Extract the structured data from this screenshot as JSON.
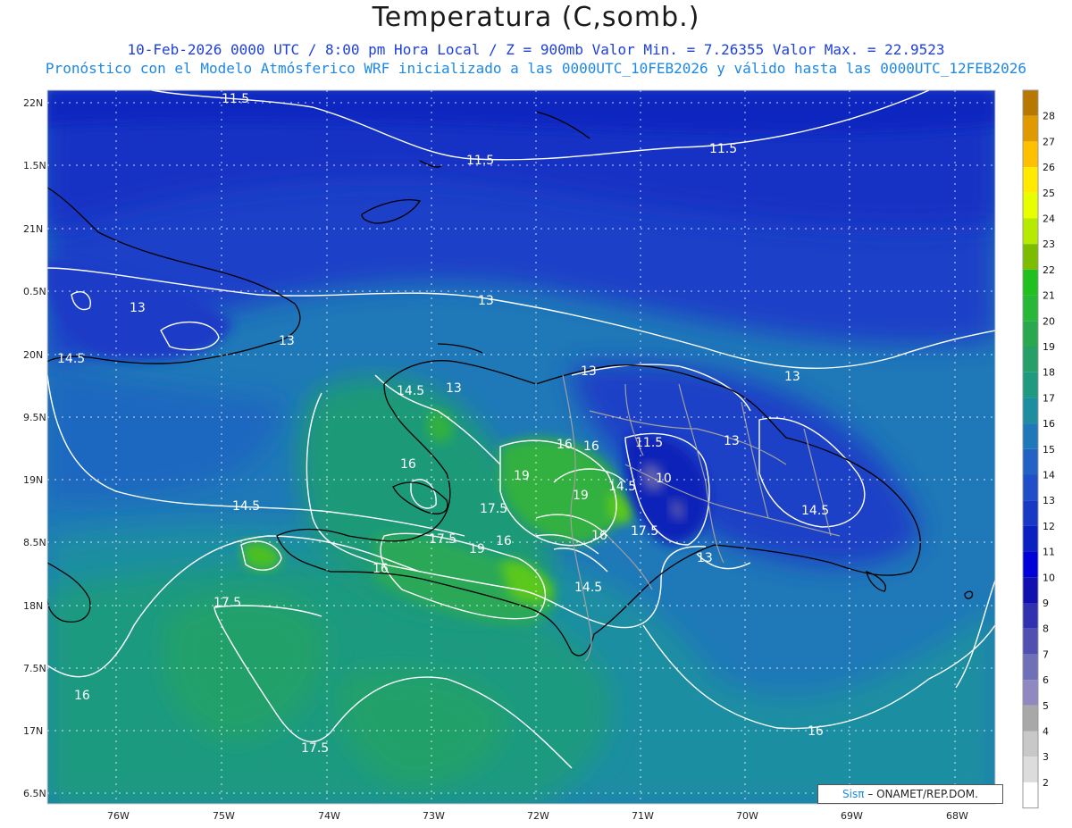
{
  "header": {
    "title": "Temperatura (C,somb.)",
    "subtitle_line1": "10-Feb-2026  0000 UTC / 8:00 pm Hora Local / Z = 900mb    Valor Min. = 7.26355  Valor Max. = 22.9523",
    "subtitle_line2": "Pronóstico con el Modelo Atmósferico WRF inicializado a las 0000UTC_10FEB2026 y válido hasta las  0000UTC_12FEB2026"
  },
  "map": {
    "lat_labels": [
      "22N",
      "1.5N",
      "21N",
      "0.5N",
      "20N",
      "9.5N",
      "19N",
      "8.5N",
      "18N",
      "7.5N",
      "17N",
      "6.5N"
    ],
    "lon_labels": [
      "76W",
      "75W",
      "74W",
      "73W",
      "72W",
      "71W",
      "70W",
      "69W",
      "68W"
    ],
    "contour_labels": [
      "11.5",
      "11.5",
      "11.5",
      "13",
      "13",
      "13",
      "14.5",
      "14.5",
      "13",
      "13",
      "11.5",
      "13",
      "16",
      "16",
      "16",
      "19",
      "19",
      "14.5",
      "10",
      "17.5",
      "17.5",
      "16",
      "17.5",
      "14.5",
      "16",
      "19",
      "16",
      "14.5",
      "13",
      "14.5",
      "17.5",
      "16",
      "17.5",
      "16"
    ],
    "colors": {
      "cold_10": "#0a1fbf",
      "c11": "#1432c8",
      "c12": "#1e48cc",
      "c13": "#1f64c4",
      "c14": "#2080b8",
      "c15": "#2398a8",
      "c16": "#1a9a7c",
      "c17": "#27a06a",
      "c18": "#2aa85a",
      "c19": "#22b33a",
      "c20": "#3cc42a",
      "c21": "#5ad21c"
    }
  },
  "colorbar": {
    "labels": [
      "28",
      "27",
      "26",
      "25",
      "24",
      "23",
      "22",
      "21",
      "20",
      "19",
      "18",
      "17",
      "16",
      "15",
      "14",
      "13",
      "12",
      "11",
      "10",
      "9",
      "8",
      "7",
      "6",
      "5",
      "4",
      "3",
      "2"
    ],
    "colors": [
      "#b87800",
      "#e09a00",
      "#ffc000",
      "#ffea00",
      "#e8ff00",
      "#b6ea00",
      "#7cbd00",
      "#20c020",
      "#28b838",
      "#2aa850",
      "#26a068",
      "#1e9a80",
      "#1d8ea0",
      "#1f78b8",
      "#2262c4",
      "#1f4ec8",
      "#1838c6",
      "#0a20c0",
      "#0000d8",
      "#1010b0",
      "#3030b0",
      "#5050b0",
      "#7070b8",
      "#9088c0",
      "#a8a8a8",
      "#c8c8c8",
      "#dcdcdc",
      "#ffffff"
    ]
  },
  "credit": {
    "brand": "Sisπ",
    "text": "– ONAMET/REP.DOM."
  }
}
